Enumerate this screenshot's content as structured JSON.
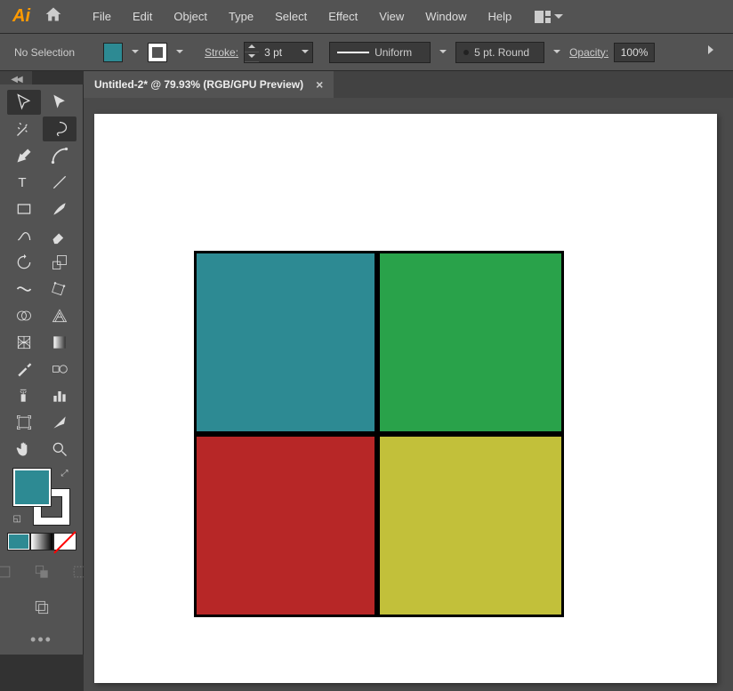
{
  "menubar": {
    "logo": "Ai",
    "items": [
      "File",
      "Edit",
      "Object",
      "Type",
      "Select",
      "Effect",
      "View",
      "Window",
      "Help"
    ]
  },
  "controlbar": {
    "selection_status": "No Selection",
    "fill_color": "#2d8a93",
    "stroke_label": "Stroke:",
    "stroke_value": "3 pt",
    "profile_label": "Uniform",
    "width_label": "5 pt. Round",
    "opacity_label": "Opacity:",
    "opacity_value": "100%"
  },
  "tab": {
    "title": "Untitled-2* @ 79.93% (RGB/GPU Preview)"
  },
  "canvas": {
    "shapes": {
      "topleft_color": "#2d8a93",
      "topright_color": "#29a24a",
      "bottomleft_color": "#b72727",
      "bottomright_color": "#c2c03a"
    }
  },
  "panel": {
    "fill_color": "#2d8a93"
  }
}
